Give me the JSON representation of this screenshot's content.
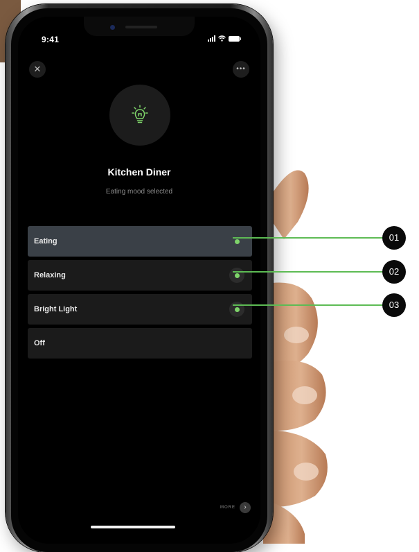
{
  "status_bar": {
    "time": "9:41"
  },
  "header": {
    "close_icon": "close-icon",
    "more_icon": "ellipsis-icon",
    "close_glyph": "✕",
    "more_glyph": "•••"
  },
  "room": {
    "icon": "lightbulb-icon",
    "title": "Kitchen Diner",
    "subtitle": "Eating mood selected"
  },
  "moods": [
    {
      "label": "Eating",
      "selected": true
    },
    {
      "label": "Relaxing",
      "selected": false
    },
    {
      "label": "Bright Light",
      "selected": false
    },
    {
      "label": "Off",
      "selected": false
    }
  ],
  "footer": {
    "more_label": "MORE",
    "chevron": "›"
  },
  "callouts": [
    {
      "label": "01"
    },
    {
      "label": "02"
    },
    {
      "label": "03"
    }
  ],
  "colors": {
    "accent_green": "#7ed36a",
    "callout_line": "#5dbb54",
    "selected_row": "#3a4047",
    "row": "#1b1b1b",
    "screen_bg": "#000000"
  }
}
